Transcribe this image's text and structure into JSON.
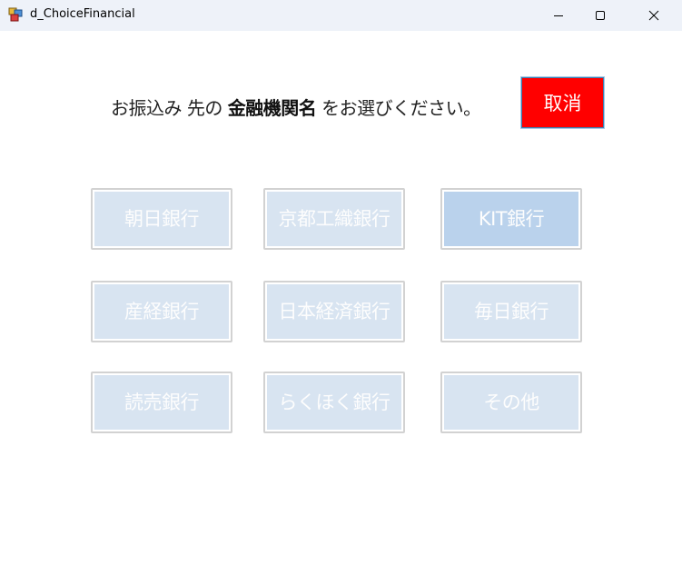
{
  "window": {
    "title": "d_ChoiceFinancial"
  },
  "prompt": {
    "before": "お振込み 先の ",
    "bold": "金融機関名",
    "after": " をお選びください。"
  },
  "cancel_button": {
    "label": "取消",
    "color": "#ff0000"
  },
  "banks": [
    {
      "label": "朝日銀行"
    },
    {
      "label": "京都工織銀行"
    },
    {
      "label": "KIT銀行",
      "selected": true
    },
    {
      "label": "産経銀行"
    },
    {
      "label": "日本経済銀行"
    },
    {
      "label": "毎日銀行"
    },
    {
      "label": "読売銀行"
    },
    {
      "label": "らくほく銀行"
    },
    {
      "label": "その他"
    }
  ]
}
